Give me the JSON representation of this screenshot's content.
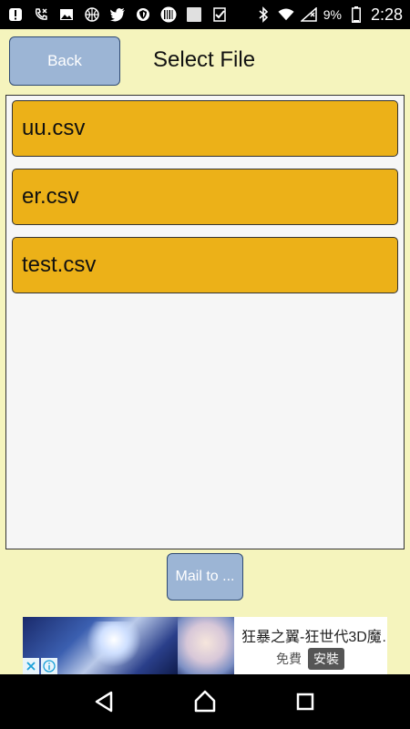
{
  "status_bar": {
    "battery_percent": "9%",
    "time": "2:28",
    "left_icons": [
      "alert-icon",
      "phone-missed-icon",
      "image-icon",
      "basketball-icon",
      "twitter-icon",
      "vpn-shield-icon",
      "barcode-icon",
      "square-icon",
      "check-icon"
    ],
    "right_icons": [
      "bluetooth-icon",
      "wifi-icon",
      "signal-icon",
      "battery-icon"
    ]
  },
  "header": {
    "back_label": "Back",
    "title": "Select File"
  },
  "files": [
    "uu.csv",
    "er.csv",
    "test.csv"
  ],
  "mail_button_label": "Mail to ...",
  "ad": {
    "title": "狂暴之翼-狂世代3D魔…",
    "price": "免費",
    "install_label": "安裝"
  },
  "colors": {
    "app_background": "#f5f4bd",
    "file_item": "#ecb118",
    "button": "#9cb5d5"
  }
}
